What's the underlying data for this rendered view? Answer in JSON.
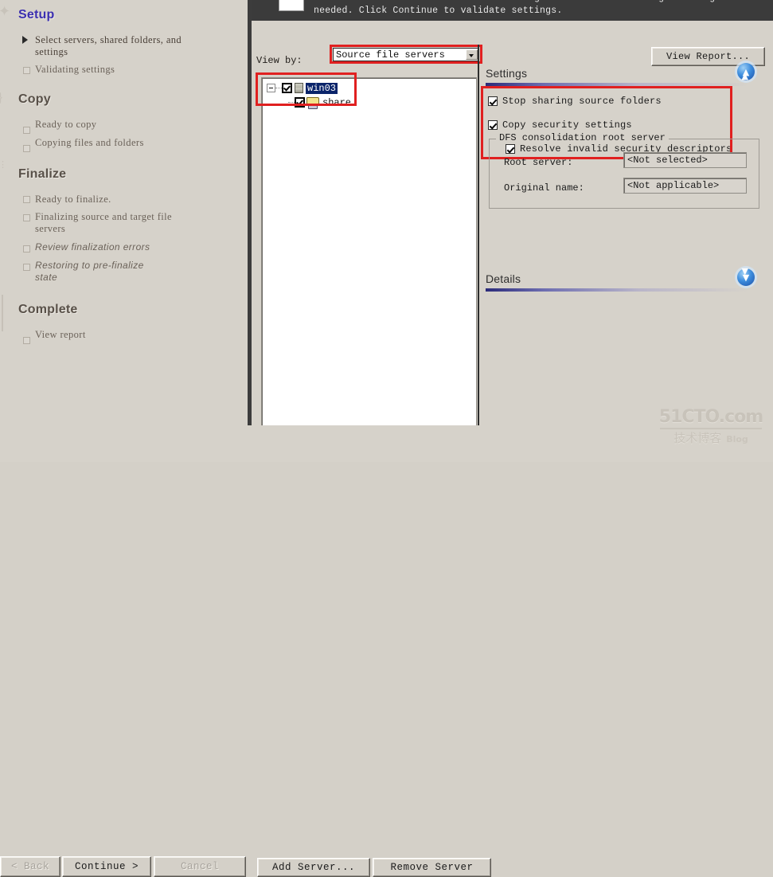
{
  "header": {
    "instruction": "Select servers and shared folders to migrate. Review and change settings if needed. Click Continue to validate settings."
  },
  "sidebar": {
    "phases": [
      {
        "title": "Setup",
        "active": true,
        "items": [
          {
            "label": "Select servers, shared folders, and settings",
            "state": "current"
          },
          {
            "label": "Validating settings",
            "state": "pending"
          }
        ]
      },
      {
        "title": "Copy",
        "active": false,
        "items": [
          {
            "label": "Ready to copy",
            "state": "pending"
          },
          {
            "label": "Copying files and folders",
            "state": "pending"
          }
        ]
      },
      {
        "title": "Finalize",
        "active": false,
        "items": [
          {
            "label": "Ready to finalize.",
            "state": "pending"
          },
          {
            "label": "Finalizing source and target file servers",
            "state": "pending"
          },
          {
            "label": "Review finalization errors",
            "state": "pending-italic"
          },
          {
            "label": "Restoring to pre-finalize state",
            "state": "pending-italic"
          }
        ]
      },
      {
        "title": "Complete",
        "active": false,
        "items": [
          {
            "label": "View report",
            "state": "pending"
          }
        ]
      }
    ]
  },
  "main": {
    "view_by_label": "View by:",
    "view_by_value": "Source file servers",
    "view_report_button": "View Report...",
    "tree": {
      "root": {
        "label": "win03",
        "checked": true,
        "selected": true,
        "expanded": true,
        "icon": "server-icon"
      },
      "children": [
        {
          "label": "share",
          "checked": true,
          "selected": false,
          "icon": "shared-folder-icon"
        }
      ]
    },
    "settings": {
      "section_title": "Settings",
      "collapse_icon": "chevron-up-icon",
      "checkboxes": [
        {
          "label": "Stop sharing source folders",
          "checked": true,
          "indent": 0
        },
        {
          "label": "Copy security settings",
          "checked": true,
          "indent": 0
        },
        {
          "label": "Resolve invalid security descriptors",
          "checked": true,
          "indent": 1
        }
      ]
    },
    "dfs": {
      "legend": "DFS consolidation root server",
      "fields": [
        {
          "label": "Root server:",
          "value": "<Not selected>"
        },
        {
          "label": "Original name:",
          "value": "<Not applicable>"
        }
      ]
    },
    "details": {
      "section_title": "Details",
      "expand_icon": "chevron-down-icon"
    }
  },
  "buttons": {
    "back": "< Back",
    "continue": "Continue >",
    "cancel": "Cancel",
    "add_server": "Add Server...",
    "remove_server": "Remove Server"
  },
  "watermark": {
    "top": "51CTO.com",
    "bottom": "技术博客",
    "blog": "Blog"
  },
  "colors": {
    "accent": "#3b2fb0",
    "highlight_box": "#e02020",
    "selection": "#0a246a",
    "window_bg": "#d6d2ca",
    "header_bg": "#3b3b3b"
  }
}
